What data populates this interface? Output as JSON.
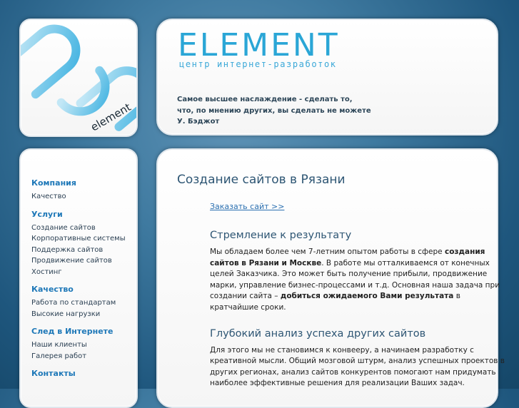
{
  "brand": {
    "name": "ELEMENT",
    "tagline": "центр интернет-разработок",
    "logo_text": "element",
    "accent": "#3aa8d8"
  },
  "header": {
    "quote_lines": [
      "Самое высшее наслаждение - сделать то,",
      "что, по мнению других, вы сделать не можете",
      "У. Бэджот"
    ]
  },
  "sidebar": {
    "groups": [
      {
        "heading": "Компания",
        "items": [
          "Качество"
        ]
      },
      {
        "heading": "Услуги",
        "items": [
          "Создание сайтов",
          "Корпоративные системы",
          "Поддержка сайтов",
          "Продвижение сайтов",
          "Хостинг"
        ]
      },
      {
        "heading": "Качество",
        "items": [
          "Работа по стандартам",
          "Высокие нагрузки"
        ]
      },
      {
        "heading": "След в Интернете",
        "items": [
          "Наши клиенты",
          "Галерея работ"
        ]
      },
      {
        "heading": "Контакты",
        "items": []
      }
    ]
  },
  "main": {
    "title": "Создание сайтов в Рязани",
    "order_link": "Заказать сайт >>",
    "sections": [
      {
        "title": "Стремление к результату",
        "lines": [
          [
            {
              "t": "Мы обладаем более чем 7-летним опытом работы в сфере "
            },
            {
              "t": "создания",
              "b": true
            }
          ],
          [
            {
              "t": "сайтов в Рязани и Москве",
              "b": true
            },
            {
              "t": ". В работе мы отталкиваемся от конечных"
            }
          ],
          [
            {
              "t": "целей Заказчика. Это может быть получение прибыли, продвижение"
            }
          ],
          [
            {
              "t": "марки, управление бизнес-процессами и т.д. Основная наша задача при"
            }
          ],
          [
            {
              "t": "создании сайта – "
            },
            {
              "t": "добиться ожидаемого Вами результата",
              "b": true
            },
            {
              "t": " в"
            }
          ],
          [
            {
              "t": "кратчайшие сроки."
            }
          ]
        ]
      },
      {
        "title": "Глубокий анализ успеха других сайтов",
        "lines": [
          [
            {
              "t": "Для этого мы не становимся к конвееру, а начинаем разработку с"
            }
          ],
          [
            {
              "t": "креативной мысли. Общий мозговой штурм, анализ успешных проектов в"
            }
          ],
          [
            {
              "t": "других регионах, анализ сайтов конкурентов помогают нам придумать"
            }
          ],
          [
            {
              "t": "наиболее эффективные решения для реализации Ваших задач."
            }
          ]
        ]
      }
    ]
  }
}
